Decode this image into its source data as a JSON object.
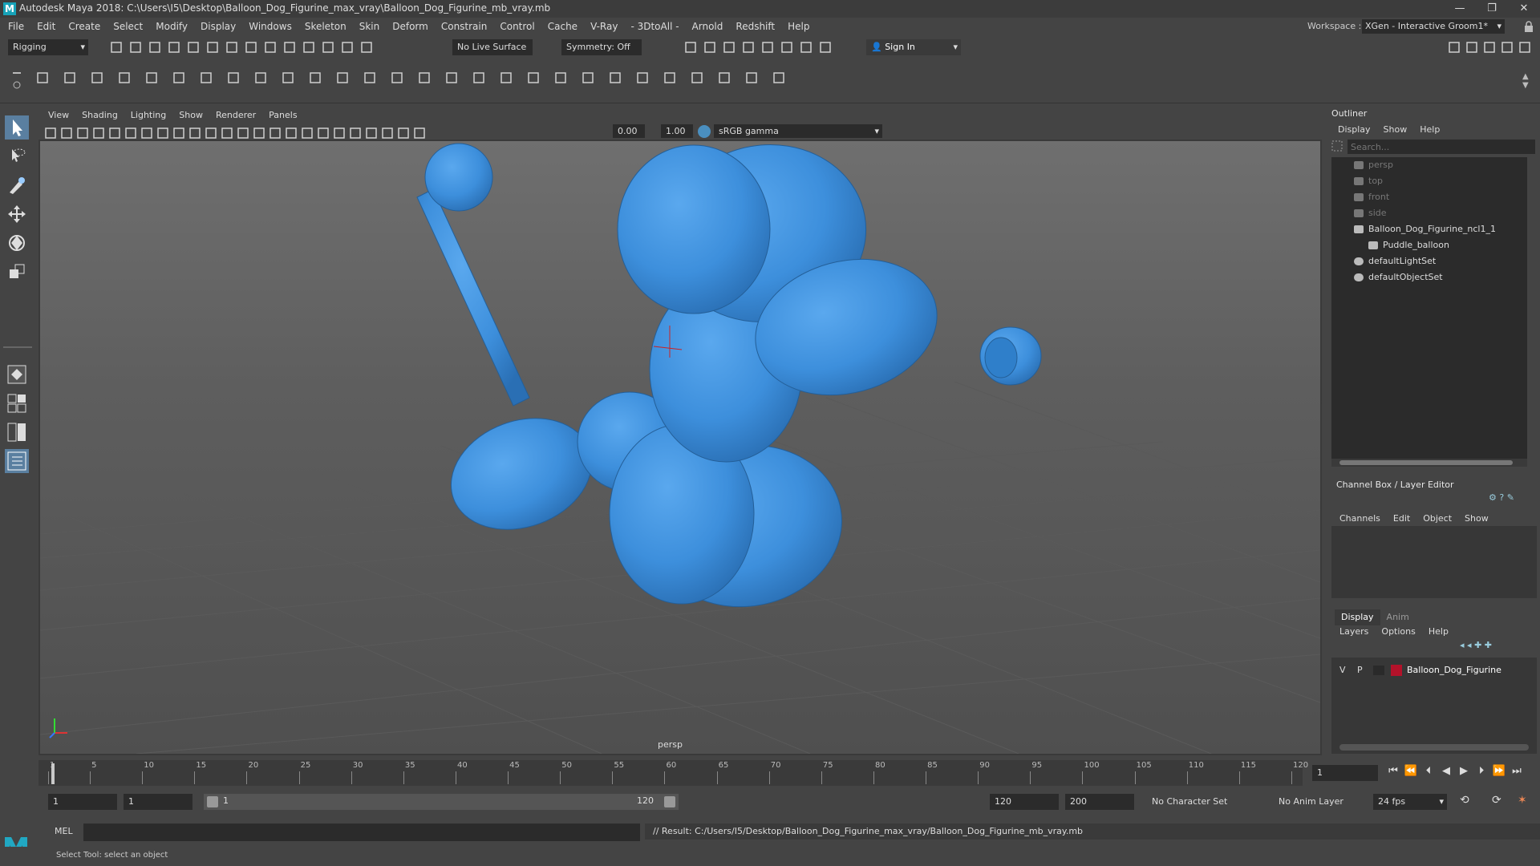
{
  "window": {
    "title": "Autodesk Maya 2018: C:\\Users\\I5\\Desktop\\Balloon_Dog_Figurine_max_vray\\Balloon_Dog_Figurine_mb_vray.mb",
    "logo": "M"
  },
  "menubar": {
    "items": [
      "File",
      "Edit",
      "Create",
      "Select",
      "Modify",
      "Display",
      "Windows",
      "Skeleton",
      "Skin",
      "Deform",
      "Constrain",
      "Control",
      "Cache",
      "V-Ray",
      "- 3DtoAll -",
      "Arnold",
      "Redshift",
      "Help"
    ],
    "workspace_label": "Workspace :",
    "workspace_value": "XGen - Interactive Groom1*"
  },
  "statusline": {
    "mode": "Rigging",
    "live_surface": "No Live Surface",
    "symmetry": "Symmetry: Off",
    "sign_in": "Sign In"
  },
  "viewport": {
    "menus": [
      "View",
      "Shading",
      "Lighting",
      "Show",
      "Renderer",
      "Panels"
    ],
    "exposure": "0.00",
    "gamma": "1.00",
    "color_space": "sRGB gamma",
    "camera_label": "persp",
    "model_color": "#3d8fdc"
  },
  "outliner": {
    "title": "Outliner",
    "menus": [
      "Display",
      "Show",
      "Help"
    ],
    "search_placeholder": "Search...",
    "items": [
      {
        "label": "persp",
        "dim": true,
        "indent": 1
      },
      {
        "label": "top",
        "dim": true,
        "indent": 1
      },
      {
        "label": "front",
        "dim": true,
        "indent": 1
      },
      {
        "label": "side",
        "dim": true,
        "indent": 1
      },
      {
        "label": "Balloon_Dog_Figurine_ncl1_1",
        "dim": false,
        "indent": 1
      },
      {
        "label": "Puddle_balloon",
        "dim": false,
        "indent": 2
      },
      {
        "label": "defaultLightSet",
        "dim": false,
        "indent": 1
      },
      {
        "label": "defaultObjectSet",
        "dim": false,
        "indent": 1
      }
    ]
  },
  "channelbox": {
    "title": "Channel Box / Layer Editor",
    "menus": [
      "Channels",
      "Edit",
      "Object",
      "Show"
    ],
    "layer_tabs": [
      "Display",
      "Anim"
    ],
    "layer_menus": [
      "Layers",
      "Options",
      "Help"
    ],
    "layer": {
      "v": "V",
      "p": "P",
      "name": "Balloon_Dog_Figurine",
      "color": "#b3122a"
    }
  },
  "timeslider": {
    "ticks": [
      "1",
      "5",
      "10",
      "15",
      "20",
      "25",
      "30",
      "35",
      "40",
      "45",
      "50",
      "55",
      "60",
      "65",
      "70",
      "75",
      "80",
      "85",
      "90",
      "95",
      "100",
      "105",
      "110",
      "115",
      "120"
    ],
    "current_frame": "1"
  },
  "rangeslider": {
    "start": "1",
    "start2": "1",
    "range_start": "1",
    "range_end": "120",
    "end": "120",
    "end2": "200",
    "char_set": "No Character Set",
    "anim_layer": "No Anim Layer",
    "fps": "24 fps"
  },
  "cmdline": {
    "lang": "MEL",
    "result": "// Result: C:/Users/I5/Desktop/Balloon_Dog_Figurine_max_vray/Balloon_Dog_Figurine_mb_vray.mb"
  },
  "helpline": {
    "text": "Select Tool: select an object"
  }
}
